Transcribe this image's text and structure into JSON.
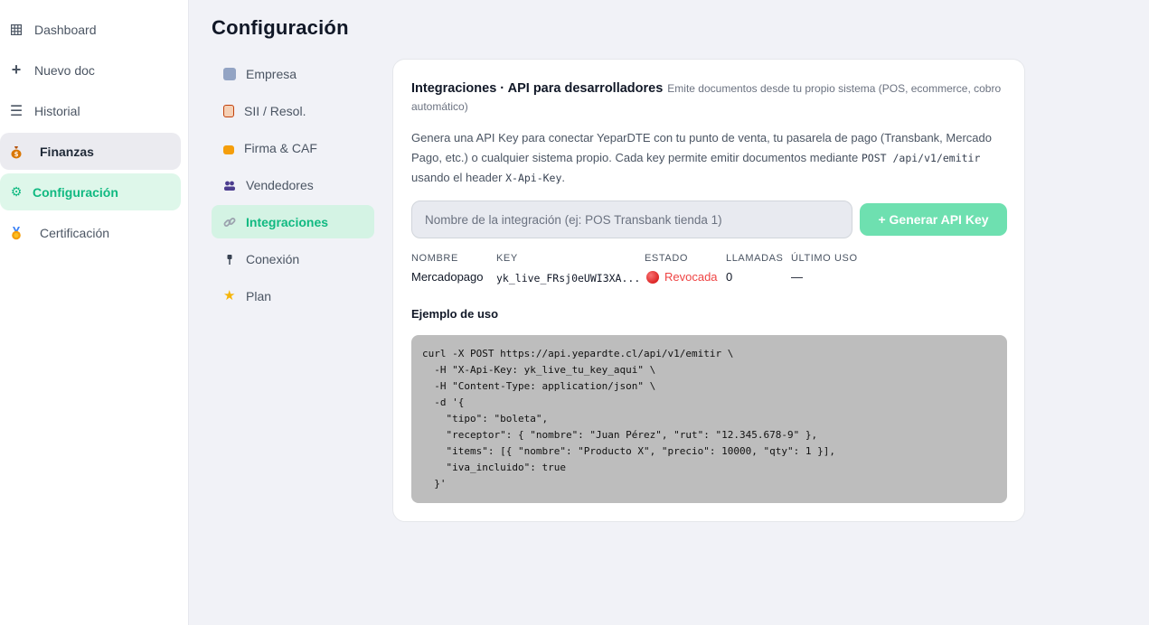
{
  "sidebar": {
    "items": [
      {
        "label": "Dashboard",
        "icon": "grid-icon"
      },
      {
        "label": "Nuevo doc",
        "icon": "plus-icon"
      },
      {
        "label": "Historial",
        "icon": "list-icon"
      },
      {
        "label": "Finanzas",
        "icon": "money-bag-icon"
      },
      {
        "label": "Configuración",
        "icon": "gear-icon"
      },
      {
        "label": "Certificación",
        "icon": "medal-icon"
      }
    ]
  },
  "page": {
    "title": "Configuración"
  },
  "subnav": {
    "items": [
      {
        "label": "Empresa",
        "icon": "building-icon"
      },
      {
        "label": "SII / Resol.",
        "icon": "clipboard-icon"
      },
      {
        "label": "Firma & CAF",
        "icon": "lock-icon"
      },
      {
        "label": "Vendedores",
        "icon": "users-icon"
      },
      {
        "label": "Integraciones",
        "icon": "link-icon"
      },
      {
        "label": "Conexión",
        "icon": "plug-icon"
      },
      {
        "label": "Plan",
        "icon": "star-icon"
      }
    ]
  },
  "panel": {
    "title": "Integraciones · API para desarrolladores",
    "subtitle": "Emite documentos desde tu propio sistema (POS, ecommerce, cobro automático)",
    "desc_1": "Genera una API Key para conectar YeparDTE con tu punto de venta, tu pasarela de pago (Transbank, Mercado Pago, etc.) o cualquier sistema propio. Cada key permite emitir documentos mediante ",
    "desc_code_1": "POST /api/v1/emitir",
    "desc_2": " usando el header ",
    "desc_code_2": "X-Api-Key",
    "desc_3": ".",
    "input_placeholder": "Nombre de la integración (ej: POS Transbank tienda 1)",
    "input_value": "",
    "generate_label": "+ Generar API Key",
    "table": {
      "headers": [
        "NOMBRE",
        "KEY",
        "ESTADO",
        "LLAMADAS",
        "ÚLTIMO USO"
      ],
      "rows": [
        {
          "nombre": "Mercadopago",
          "key": "yk_live_FRsj0eUWI3XA...",
          "estado": "Revocada",
          "llamadas": "0",
          "ultimo_uso": "—"
        }
      ]
    },
    "example_title": "Ejemplo de uso",
    "code": "curl -X POST https://api.yepardte.cl/api/v1/emitir \\\n  -H \"X-Api-Key: yk_live_tu_key_aqui\" \\\n  -H \"Content-Type: application/json\" \\\n  -d '{\n    \"tipo\": \"boleta\",\n    \"receptor\": { \"nombre\": \"Juan Pérez\", \"rut\": \"12.345.678-9\" },\n    \"items\": [{ \"nombre\": \"Producto X\", \"precio\": 10000, \"qty\": 1 }],\n    \"iva_incluido\": true\n  }'"
  },
  "colors": {
    "accent": "#10b981",
    "revoked": "#ef4444",
    "button": "#6ee0b0"
  }
}
